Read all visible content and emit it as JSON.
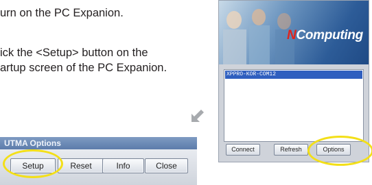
{
  "instructions": {
    "line1": "urn on the PC Expanion.",
    "line2": "ick the <Setup> button on the",
    "line3": "artup screen of the PC Expanion."
  },
  "utma_dialog": {
    "title": "UTMA Options",
    "buttons": {
      "setup": "Setup",
      "reset": "Reset",
      "info": "Info",
      "close": "Close"
    },
    "highlight_color": "#f3df18"
  },
  "ncomputing_screen": {
    "logo_prefix": "N",
    "logo_text": "Computing",
    "list_items": [
      "XPPRO-KOR-COM12"
    ],
    "buttons": {
      "connect": "Connect",
      "refresh": "Refresh",
      "options": "Options"
    },
    "brand_red": "#e2231a",
    "banner_blue": "#2d5c98"
  },
  "arrow_icon": "arrow-down-left-icon"
}
